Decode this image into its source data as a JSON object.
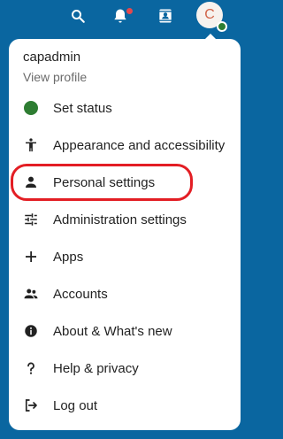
{
  "topbar": {
    "icons": {
      "search": "magnify-icon",
      "notifications": "bell-icon",
      "contacts": "contacts-icon"
    },
    "avatar_letter": "C",
    "accent": "#0a66a0"
  },
  "menu": {
    "user": {
      "name": "capadmin",
      "view_profile": "View profile"
    },
    "items": [
      {
        "label": "Set status",
        "icon": "status-dot-icon"
      },
      {
        "label": "Appearance and accessibility",
        "icon": "accessibility-icon"
      },
      {
        "label": "Personal settings",
        "icon": "person-icon"
      },
      {
        "label": "Administration settings",
        "icon": "tune-icon"
      },
      {
        "label": "Apps",
        "icon": "plus-icon"
      },
      {
        "label": "Accounts",
        "icon": "accounts-icon"
      },
      {
        "label": "About & What's new",
        "icon": "info-icon"
      },
      {
        "label": "Help & privacy",
        "icon": "help-icon"
      },
      {
        "label": "Log out",
        "icon": "logout-icon"
      }
    ],
    "highlight_color": "#e31e24",
    "status_color": "#2e7d32"
  }
}
